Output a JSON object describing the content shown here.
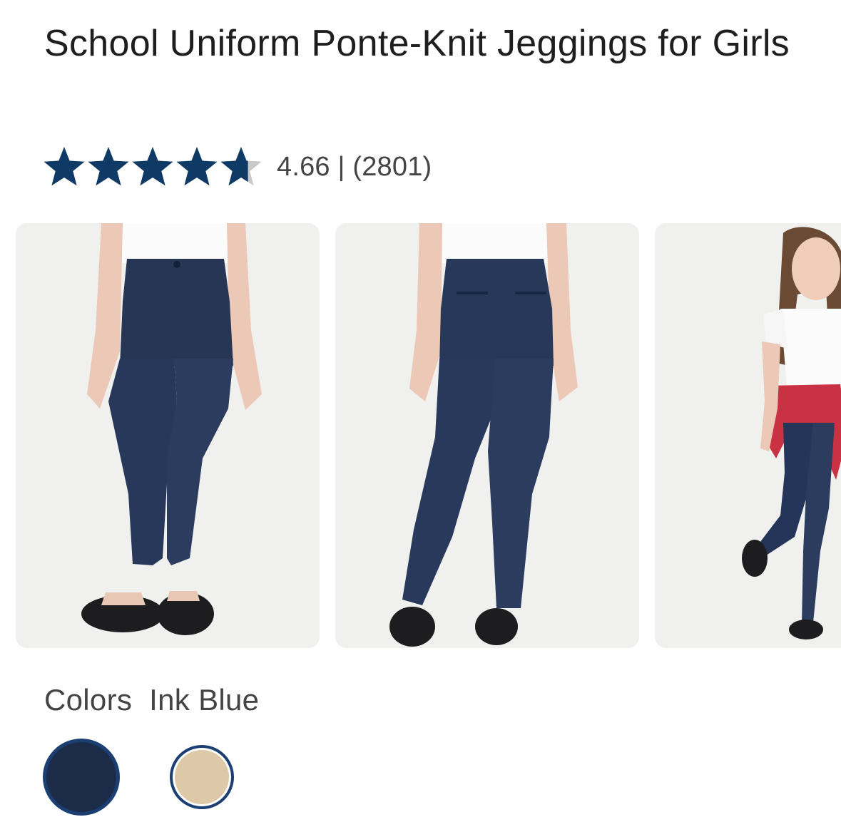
{
  "product": {
    "title": "School Uniform Ponte-Knit Jeggings for Girls"
  },
  "rating": {
    "score": 4.66,
    "max": 5,
    "text": "4.66 | (2801)",
    "star_color": "#0f3a66",
    "empty_star_color": "#c9c9c9"
  },
  "gallery": {
    "images": [
      {
        "name": "front-view-photo"
      },
      {
        "name": "back-view-photo"
      },
      {
        "name": "model-full-body-photo"
      }
    ]
  },
  "colors": {
    "label": "Colors",
    "selected_name": "Ink Blue",
    "swatches": [
      {
        "name": "Ink Blue",
        "color": "#1b2b48",
        "selected": true
      },
      {
        "name": "Khaki",
        "color": "#ddc9a8",
        "selected": false
      }
    ],
    "ring_color": "#1b3f72"
  }
}
